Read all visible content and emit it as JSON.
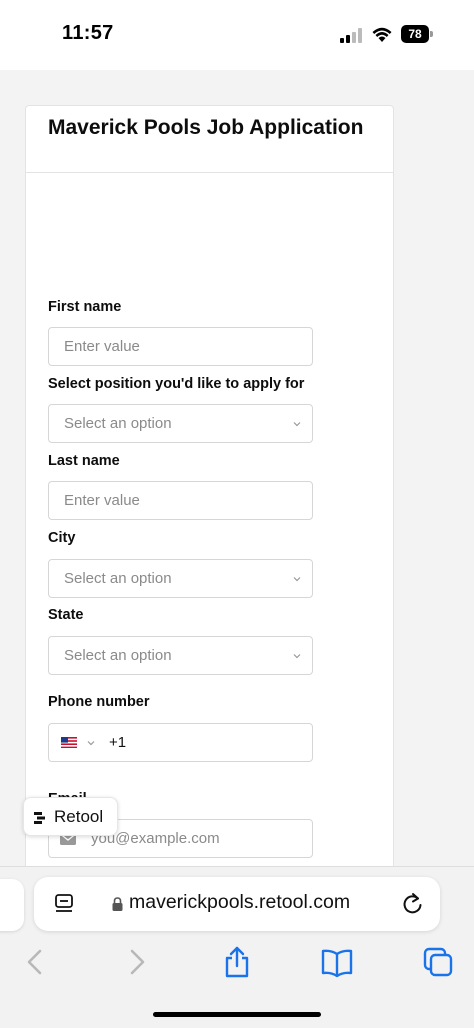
{
  "status_bar": {
    "time": "11:57",
    "battery": "78"
  },
  "form": {
    "title": "Maverick Pools Job Application",
    "fields": {
      "first_name": {
        "label": "First name",
        "placeholder": "Enter value"
      },
      "position": {
        "label": "Select position you'd like to apply for",
        "placeholder": "Select an option"
      },
      "last_name": {
        "label": "Last name",
        "placeholder": "Enter value"
      },
      "city": {
        "label": "City",
        "placeholder": "Select an option"
      },
      "state": {
        "label": "State",
        "placeholder": "Select an option"
      },
      "phone": {
        "label": "Phone number",
        "country_code": "+1",
        "flag_icon": "us-flag-icon"
      },
      "email": {
        "label": "Email",
        "placeholder": "you@example.com",
        "icon": "mail-icon"
      }
    }
  },
  "retool_badge": {
    "label": "Retool"
  },
  "browser": {
    "url": "maverickpools.retool.com",
    "icons": [
      "reader-icon",
      "lock-icon",
      "reload-icon",
      "back-icon",
      "forward-icon",
      "share-icon",
      "bookmarks-icon",
      "tabs-icon"
    ],
    "accent_color": "#1a73e8"
  }
}
